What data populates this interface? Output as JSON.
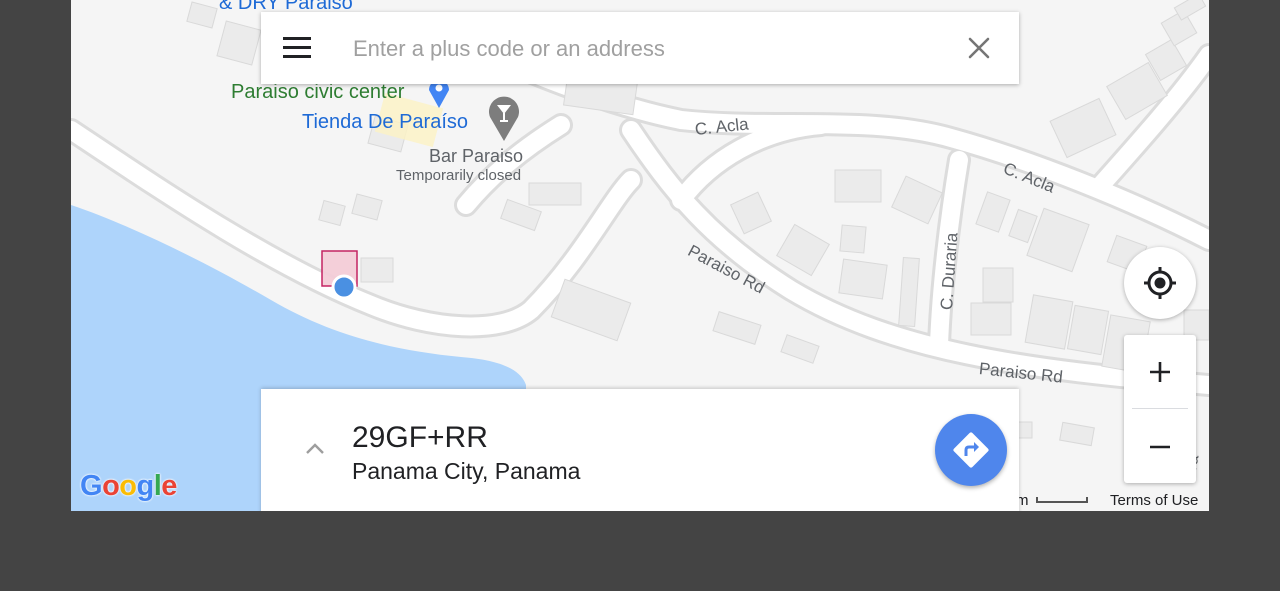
{
  "search": {
    "placeholder": "Enter a plus code or an address",
    "value": ""
  },
  "map": {
    "pois": {
      "partial_top": "& DRY Paraiso",
      "civic_center": "Paraiso civic center",
      "tienda": "Tienda De Paraíso",
      "bar": "Bar Paraiso",
      "bar_status": "Temporarily closed"
    },
    "roads": {
      "c_acla_1": "C. Acla",
      "c_acla_2": "C. Acla",
      "paraiso_rd_1": "Paraiso Rd",
      "paraiso_rd_2": "Paraiso Rd",
      "c_duraria": "C. Duraria",
      "edge_fragment": "ra"
    },
    "scale_unit": "m",
    "terms": "Terms of Use",
    "logo": [
      "G",
      "o",
      "o",
      "g",
      "l",
      "e"
    ],
    "logo_colors": [
      "#4285f4",
      "#ea4335",
      "#fbbc05",
      "#4285f4",
      "#34a853",
      "#ea4335"
    ]
  },
  "card": {
    "plus_code": "29GF+RR",
    "locality": "Panama City, Panama"
  },
  "colors": {
    "accent": "#4f86ec",
    "water": "#aed4fb",
    "location_dot": "#4a90e2"
  },
  "icons": [
    "menu-icon",
    "close-icon",
    "poi-pin-icon",
    "bar-icon",
    "my-location-icon",
    "zoom-in-icon",
    "zoom-out-icon",
    "chevron-up-icon",
    "directions-icon"
  ]
}
